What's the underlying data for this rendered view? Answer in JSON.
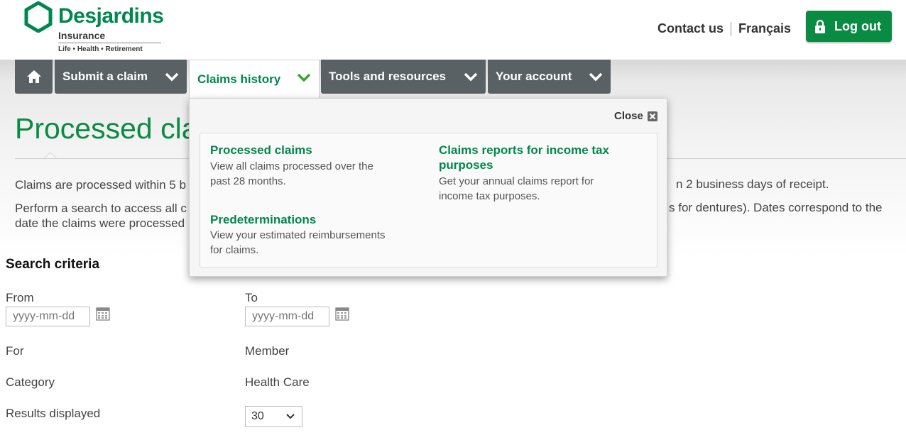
{
  "brand": {
    "name": "Desjardins",
    "sub": "Insurance",
    "tagline": "Life • Health • Retirement"
  },
  "header": {
    "contact": "Contact us",
    "language": "Français",
    "logout": "Log out"
  },
  "nav": {
    "items": [
      {
        "label": "Submit a claim"
      },
      {
        "label": "Claims history"
      },
      {
        "label": "Tools and resources"
      },
      {
        "label": "Your account"
      }
    ]
  },
  "page": {
    "title": "Processed cla",
    "para1_left": "Claims are processed within 5 b",
    "para1_right": "n 2 business days of receipt.",
    "para2_left_line1": "Perform a search to access all c",
    "para2_left_line2": "date the claims were processed",
    "para2_right": "s for dentures). Dates correspond to the"
  },
  "dropdown": {
    "close": "Close",
    "links": [
      {
        "title": "Processed claims",
        "desc_line1": "View all claims processed over the",
        "desc_line2": "past 28 months."
      },
      {
        "title": "Predeterminations",
        "desc_line1": "View your estimated reimbursements",
        "desc_line2": "for claims."
      },
      {
        "title_line1": "Claims reports for income tax",
        "title_line2": "purposes",
        "desc_line1": "Get your annual claims report for",
        "desc_line2": "income tax purposes."
      }
    ]
  },
  "search": {
    "title": "Search criteria",
    "from_label": "From",
    "to_label": "To",
    "from_placeholder": "yyyy-mm-dd",
    "to_placeholder": "yyyy-mm-dd",
    "for_label": "For",
    "for_value": "Member",
    "category_label": "Category",
    "category_value": "Health Care",
    "results_label": "Results displayed",
    "results_value": "30"
  },
  "colors": {
    "brand_green": "#00874e",
    "button_green": "#0a8b43",
    "nav_gray": "#596165"
  },
  "icons": [
    "desjardins-logo-icon",
    "lock-icon",
    "home-icon",
    "chevron-down-icon",
    "close-icon",
    "calendar-icon"
  ]
}
